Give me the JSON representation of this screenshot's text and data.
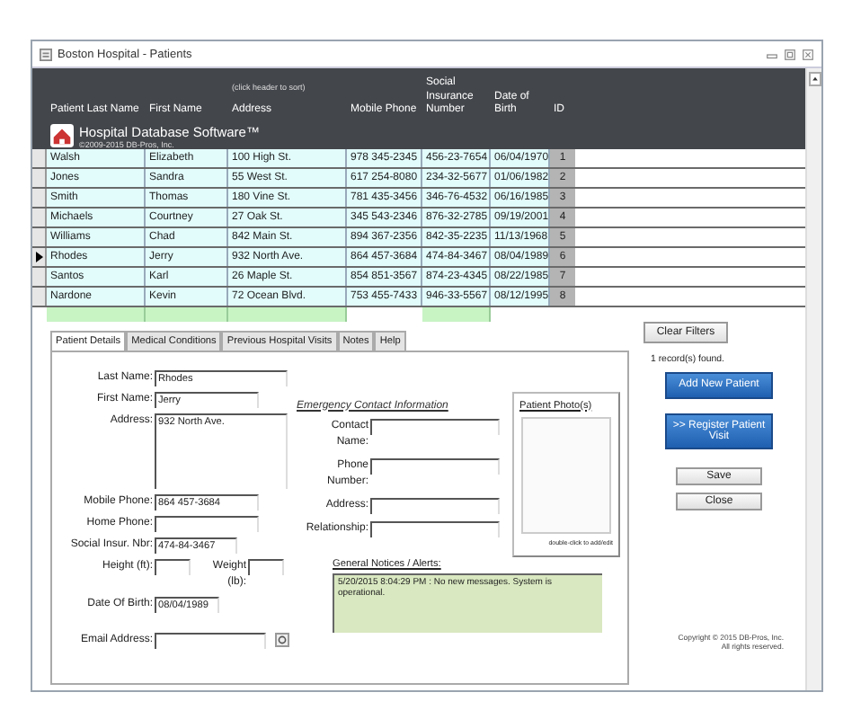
{
  "window": {
    "title": "Boston Hospital - Patients"
  },
  "header": {
    "app_name": "Hospital Database Software™",
    "copyright": "©2009-2015 DB-Pros, Inc.",
    "sort_hint": "(click header to sort)"
  },
  "table": {
    "columns": [
      "Patient Last Name",
      "First Name",
      "Address",
      "Mobile Phone",
      "Social Insurance Number",
      "Date of Birth",
      "ID"
    ],
    "rows": [
      {
        "cells": [
          "Walsh",
          "Elizabeth",
          "100 High St.",
          "978 345-2345",
          "456-23-7654",
          "06/04/1970",
          "1"
        ],
        "selected": false
      },
      {
        "cells": [
          "Jones",
          "Sandra",
          "55 West St.",
          "617 254-8080",
          "234-32-5677",
          "01/06/1982",
          "2"
        ],
        "selected": false
      },
      {
        "cells": [
          "Smith",
          "Thomas",
          "180 Vine St.",
          "781 435-3456",
          "346-76-4532",
          "06/16/1985",
          "3"
        ],
        "selected": false
      },
      {
        "cells": [
          "Michaels",
          "Courtney",
          "27 Oak St.",
          "345 543-2346",
          "876-32-2785",
          "09/19/2001",
          "4"
        ],
        "selected": false
      },
      {
        "cells": [
          "Williams",
          "Chad",
          "842 Main St.",
          "894 367-2356",
          "842-35-2235",
          "11/13/1968",
          "5"
        ],
        "selected": false
      },
      {
        "cells": [
          "Rhodes",
          "Jerry",
          "932 North Ave.",
          "864 457-3684",
          "474-84-3467",
          "08/04/1989",
          "6"
        ],
        "selected": true
      },
      {
        "cells": [
          "Santos",
          "Karl",
          "26 Maple St.",
          "854 851-3567",
          "874-23-4345",
          "08/22/1985",
          "7"
        ],
        "selected": false
      },
      {
        "cells": [
          "Nardone",
          "Kevin",
          "72 Ocean Blvd.",
          "753 455-7433",
          "946-33-5567",
          "08/12/1995",
          "8"
        ],
        "selected": false
      }
    ]
  },
  "tabs": [
    {
      "label": "Patient Details",
      "selected": true
    },
    {
      "label": "Medical Conditions",
      "selected": false
    },
    {
      "label": "Previous Hospital Visits",
      "selected": false
    },
    {
      "label": "Notes",
      "selected": false
    },
    {
      "label": "Help",
      "selected": false
    }
  ],
  "patient": {
    "last_name": {
      "label": "Last Name:",
      "value": "Rhodes"
    },
    "first_name": {
      "label": "First Name:",
      "value": "Jerry"
    },
    "address": {
      "label": "Address:",
      "value": "932 North Ave."
    },
    "mobile_phone": {
      "label": "Mobile Phone:",
      "value": "864 457-3684"
    },
    "home_phone": {
      "label": "Home Phone:"
    },
    "social_insurance": {
      "label": "Social Insur. Nbr:",
      "value": "474-84-3467"
    },
    "height": {
      "label": "Height (ft):"
    },
    "weight": {
      "label": "Weight (lb):"
    },
    "date_of_birth": {
      "label": "Date Of Birth:",
      "value": "08/04/1989"
    },
    "email": {
      "label": "Email Address:"
    }
  },
  "emergency_contact": {
    "title": "Emergency Contact Information",
    "fields": [
      "Contact Name:",
      "Phone Number:",
      "Address:",
      "Relationship:"
    ]
  },
  "photo": {
    "title": "Patient Photo(s)",
    "hint": "double-click to add/edit"
  },
  "notices": {
    "title": "General Notices / Alerts:",
    "text": "5/20/2015 8:04:29 PM : No new messages.  System is operational."
  },
  "side": {
    "clear_filters": "Clear Filters",
    "records_found": "1 record(s) found.",
    "add_patient": "Add New Patient",
    "register_visit": ">> Register Patient Visit",
    "save": "Save",
    "close": "Close",
    "copyright": "Copyright © 2015 DB-Pros, Inc.",
    "rights": "All rights reserved."
  }
}
